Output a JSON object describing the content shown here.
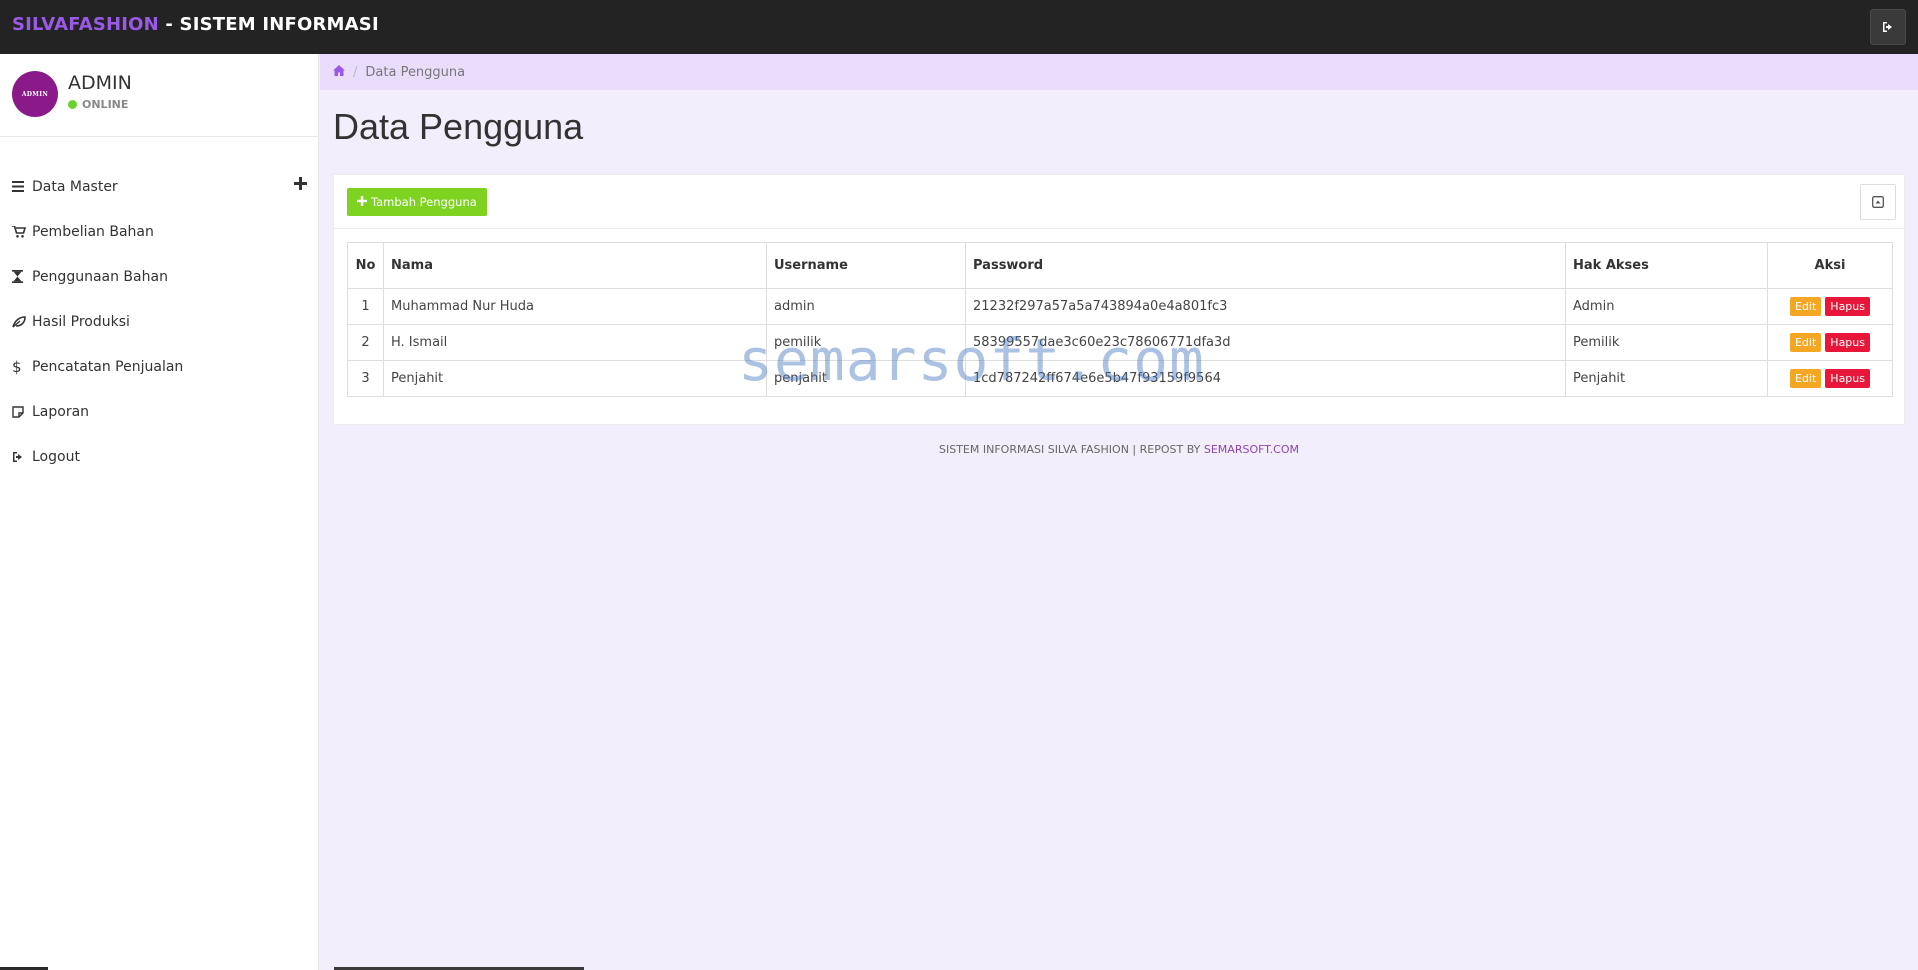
{
  "app": {
    "brand_primary": "SILVAFASHION",
    "brand_secondary": " - SISTEM INFORMASI",
    "brand_color": "#9b59e8",
    "logout_icon": "sign-out-icon"
  },
  "user": {
    "avatar_text": "ADMIN",
    "name": "ADMIN",
    "status": "ONLINE",
    "status_color": "#6ad22c"
  },
  "sidebar": {
    "items": [
      {
        "label": "Data Master",
        "icon": "bars-icon"
      },
      {
        "label": "Pembelian Bahan",
        "icon": "shopping-cart-icon"
      },
      {
        "label": "Penggunaan Bahan",
        "icon": "hourglass-icon"
      },
      {
        "label": "Hasil Produksi",
        "icon": "leaf-icon"
      },
      {
        "label": "Pencatatan Penjualan",
        "icon": "dollar-icon"
      },
      {
        "label": "Laporan",
        "icon": "sticky-note-icon"
      },
      {
        "label": "Logout",
        "icon": "sign-out-icon"
      }
    ]
  },
  "breadcrumb": {
    "home_icon": "home-icon",
    "current": "Data Pengguna"
  },
  "page": {
    "title": "Data Pengguna",
    "add_button": "Tambah Pengguna"
  },
  "table": {
    "headers": [
      "No",
      "Nama",
      "Username",
      "Password",
      "Hak Akses",
      "Aksi"
    ],
    "rows": [
      {
        "no": "1",
        "nama": "Muhammad Nur Huda",
        "username": "admin",
        "password": "21232f297a57a5a743894a0e4a801fc3",
        "hak_akses": "Admin"
      },
      {
        "no": "2",
        "nama": "H. Ismail",
        "username": "pemilik",
        "password": "58399557dae3c60e23c78606771dfa3d",
        "hak_akses": "Pemilik"
      },
      {
        "no": "3",
        "nama": "Penjahit",
        "username": "penjahit",
        "password": "1cd787242ff674e6e5b47f93159f9564",
        "hak_akses": "Penjahit"
      }
    ],
    "edit_label": "Edit",
    "delete_label": "Hapus"
  },
  "watermark": "semarsoft.com",
  "footer": {
    "text": "SISTEM INFORMASI SILVA FASHION | REPOST BY ",
    "link": "SEMARSOFT.COM"
  }
}
